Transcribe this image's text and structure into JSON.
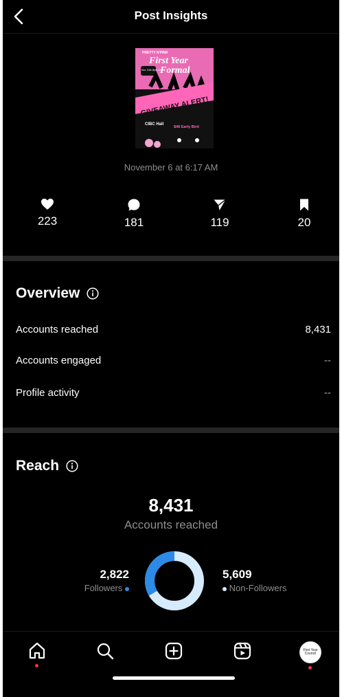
{
  "header": {
    "title": "Post Insights"
  },
  "post": {
    "date": "November 6 at 6:17 AM",
    "image_text": {
      "brand": "PRETTY N'PINK",
      "title_line1": "First Year",
      "title_line2": "Formal",
      "banner": "GIVEAWAY ALERT!",
      "date_badge": "Nov. 24th 8pm-12am",
      "venue": "CIBC Hall",
      "ticket": "$48 Early Bird"
    }
  },
  "stats": {
    "likes": "223",
    "comments": "181",
    "shares": "119",
    "saves": "20"
  },
  "overview": {
    "title": "Overview",
    "rows": [
      {
        "label": "Accounts reached",
        "value": "8,431"
      },
      {
        "label": "Accounts engaged",
        "value": "--"
      },
      {
        "label": "Profile activity",
        "value": "--"
      }
    ]
  },
  "reach": {
    "title": "Reach",
    "total": "8,431",
    "total_label": "Accounts reached",
    "followers_count": "2,822",
    "followers_label": "Followers",
    "non_followers_count": "5,609",
    "non_followers_label": "Non-Followers",
    "followers_share": 0.335,
    "colors": {
      "followers": "#2d8ae6",
      "non_followers": "#d6ebfb"
    }
  },
  "tabbar": {
    "items": [
      "home-icon",
      "search-icon",
      "create-icon",
      "reels-icon",
      "profile-avatar"
    ],
    "avatar_text": "First Year Council"
  }
}
